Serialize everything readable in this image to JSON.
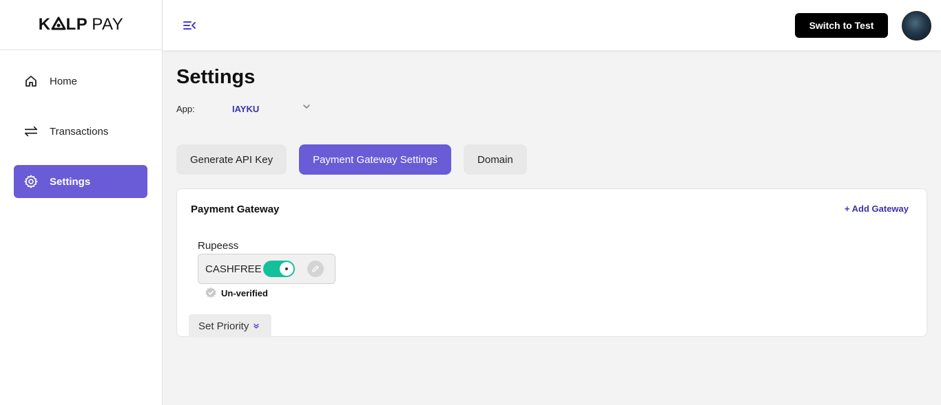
{
  "brand": {
    "logo_bold": "KℵLP",
    "logo_light": "PAY"
  },
  "sidebar": {
    "items": [
      {
        "label": "Home",
        "icon": "home-icon"
      },
      {
        "label": "Transactions",
        "icon": "arrows-swap-icon"
      },
      {
        "label": "Settings",
        "icon": "gear-icon",
        "active": true
      }
    ]
  },
  "header": {
    "switch_label": "Switch to Test",
    "menu_icon": "collapse-menu-icon"
  },
  "page": {
    "title": "Settings",
    "app_label": "App:",
    "app_value": "IAYKU"
  },
  "tabs": [
    {
      "label": "Generate API Key"
    },
    {
      "label": "Payment Gateway Settings",
      "active": true
    },
    {
      "label": "Domain"
    }
  ],
  "card": {
    "title": "Payment Gateway",
    "add_label": "+ Add Gateway",
    "currency": "Rupeess",
    "gateway": {
      "name": "CASHFREE",
      "enabled": true
    },
    "status": "Un-verified",
    "priority_label": "Set Priority"
  },
  "colors": {
    "accent": "#6a5bd7",
    "link": "#3b33a8",
    "toggle_on": "#14c09a"
  }
}
